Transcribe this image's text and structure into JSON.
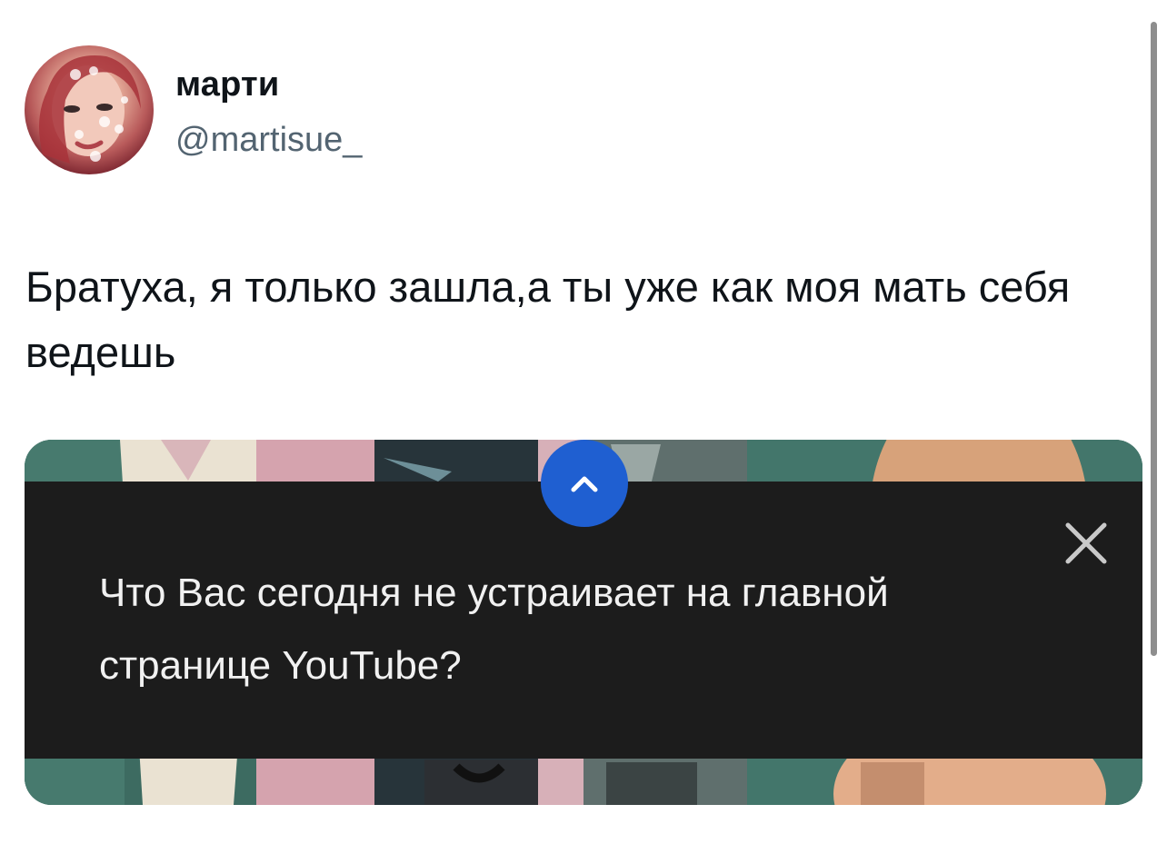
{
  "tweet": {
    "author": {
      "display_name": "марти",
      "handle": "@martisue_"
    },
    "text": "Братуха, я только зашла,а ты уже как моя мать себя ведешь"
  },
  "media": {
    "popup_text": "Что Вас сегодня не устраивает на главной странице YouTube?",
    "close_icon": "close-icon",
    "expand_icon": "chevron-up-icon",
    "accent_color": "#1f5fd1"
  }
}
